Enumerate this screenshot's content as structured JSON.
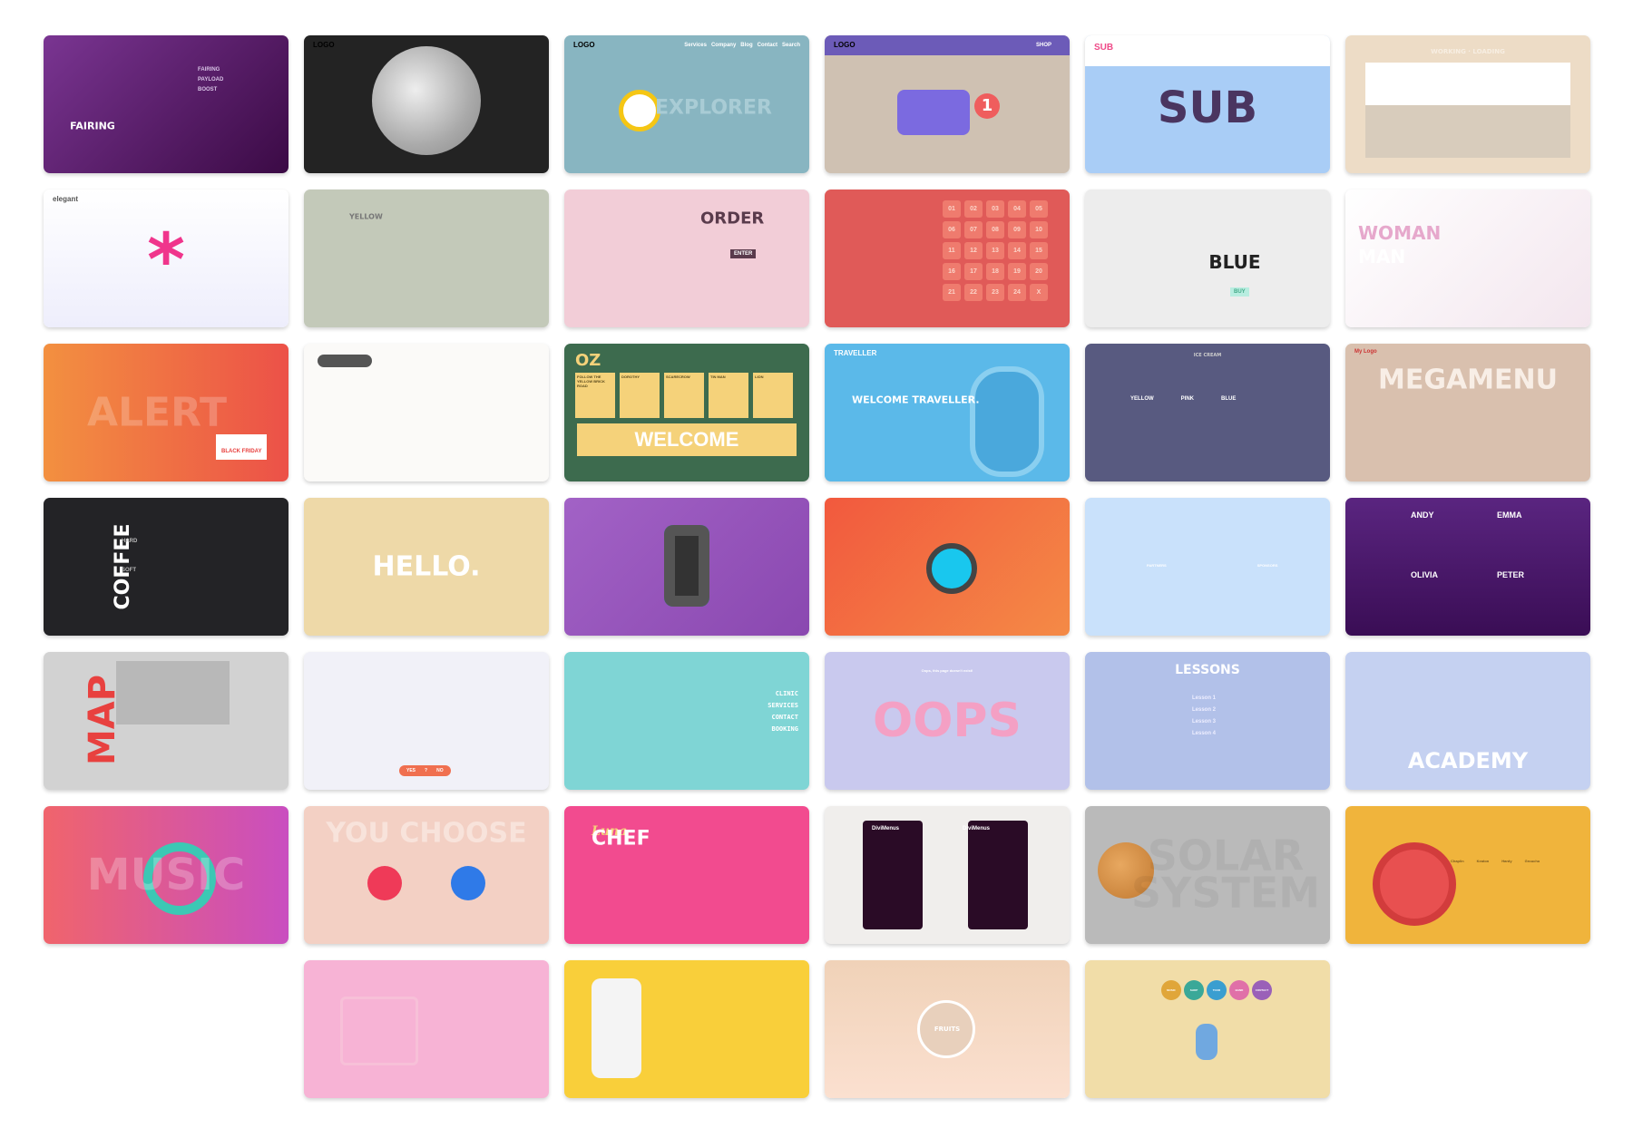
{
  "cards": [
    {
      "name": "fairing",
      "bg": "linear-gradient(135deg,#7a3592,#3b0a45)",
      "title": "FAIRING",
      "labels": [
        "FAIRING",
        "PAYLOAD",
        "BOOST"
      ]
    },
    {
      "name": "moon",
      "bg": "#232323",
      "logo": "LOGO"
    },
    {
      "name": "explorer",
      "bg": "#88b5c1",
      "logo": "LOGO",
      "title": "EXPLORER",
      "title_color": "#a9ccd5",
      "labels": [
        "Services",
        "Company",
        "Blog",
        "Contact",
        "Search"
      ]
    },
    {
      "name": "shop-cart",
      "bg": "#cfc1b2",
      "logo": "LOGO",
      "title": "1",
      "labels": [
        "SHOP"
      ]
    },
    {
      "name": "sub",
      "bg": "#a9cdf6",
      "logo": "SUB",
      "title": "SUB"
    },
    {
      "name": "working-loading",
      "bg": "#eddcc6",
      "title": "WORKING · LOADING"
    },
    {
      "name": "elegant",
      "bg": "linear-gradient(#fff,#eeeefc)",
      "logo": "elegant",
      "title": "*"
    },
    {
      "name": "macarons",
      "bg": "#c3c9b9",
      "title": "YELLOW"
    },
    {
      "name": "order",
      "bg": "#f2cdd7",
      "title": "ORDER",
      "labels": [
        "ENTER"
      ]
    },
    {
      "name": "advent",
      "bg": "#e05a58",
      "labels": [
        "01",
        "02",
        "03",
        "04",
        "05",
        "06",
        "07",
        "08",
        "09",
        "10",
        "11",
        "12",
        "13",
        "14",
        "15",
        "16",
        "17",
        "18",
        "19",
        "20",
        "21",
        "22",
        "23",
        "24",
        "X"
      ]
    },
    {
      "name": "blue",
      "bg": "#ededed",
      "title": "BLUE",
      "labels": [
        "BUY"
      ]
    },
    {
      "name": "woman-man",
      "bg": "linear-gradient(135deg,#fff,#f3e6ee)",
      "title": "WOMAN",
      "labels": [
        "MAN"
      ]
    },
    {
      "name": "alert",
      "bg": "linear-gradient(90deg,#f39040,#ec5148)",
      "title": "ALERT",
      "labels": [
        "BLACK FRIDAY"
      ]
    },
    {
      "name": "icons",
      "bg": "#fbfaf8"
    },
    {
      "name": "oz",
      "bg": "#3d6b4e",
      "title": "OZ",
      "labels": [
        "FOLLOW THE YELLOW BRICK ROAD",
        "DOROTHY",
        "SCARECROW",
        "TIN MAN",
        "LION"
      ],
      "extra": "WELCOME"
    },
    {
      "name": "traveller",
      "bg": "#5bb9e9",
      "logo": "TRAVELLER",
      "title": "WELCOME TRAVELLER."
    },
    {
      "name": "ice-cream",
      "bg": "#585a80",
      "title": "ICE CREAM",
      "labels": [
        "YELLOW",
        "PINK",
        "BLUE"
      ]
    },
    {
      "name": "megamenu",
      "bg": "#d9c0ae",
      "logo": "My Logo",
      "title": "MEGAMENU"
    },
    {
      "name": "coffee",
      "bg": "#232326",
      "title": "COFFEE",
      "labels": [
        "HARD",
        "SOFT"
      ]
    },
    {
      "name": "hello",
      "bg": "#eed9a8",
      "title": "HELLO."
    },
    {
      "name": "watch",
      "bg": "linear-gradient(135deg,#a262c6,#8a48b0)"
    },
    {
      "name": "watches",
      "bg": "linear-gradient(135deg,#f2593e,#f48a46)"
    },
    {
      "name": "partners",
      "bg": "#c9e1fb",
      "labels": [
        "PARTNERS",
        "SPONSORS"
      ]
    },
    {
      "name": "team",
      "bg": "linear-gradient(#5a2580,#3a0d55)",
      "labels": [
        "ANDY",
        "EMMA",
        "OLIVIA",
        "PETER"
      ]
    },
    {
      "name": "map",
      "bg": "#d2d2d2",
      "title": "MAP"
    },
    {
      "name": "laptop",
      "bg": "#f1f1f8",
      "labels": [
        "YES",
        "?",
        "NO"
      ]
    },
    {
      "name": "clinic",
      "bg": "#7fd5d5",
      "labels": [
        "CLINIC",
        "SERVICES",
        "CONTACT",
        "BOOKING"
      ]
    },
    {
      "name": "oops",
      "bg": "#c9c9ee",
      "title": "OOPS",
      "labels": [
        "Oops, this page doesn't exist!"
      ]
    },
    {
      "name": "lessons",
      "bg": "#b2c1e9",
      "title": "LESSONS",
      "labels": [
        "Lesson 1",
        "Lesson 2",
        "Lesson 3",
        "Lesson 4"
      ]
    },
    {
      "name": "academy",
      "bg": "#c5d1f1",
      "title": "ACADEMY"
    },
    {
      "name": "music",
      "bg": "linear-gradient(90deg,#f0646c,#c94ec0)",
      "title": "MUSIC"
    },
    {
      "name": "you-choose",
      "bg": "#f3d0c4",
      "title": "YOU CHOOSE"
    },
    {
      "name": "chef",
      "bg": "#f24b8f",
      "logo": "Luna",
      "title": "CHEF"
    },
    {
      "name": "divimenus",
      "bg": "#f0eeec",
      "labels": [
        "DiviMenus",
        "DiviMenus"
      ]
    },
    {
      "name": "solar",
      "bg": "#bababa",
      "title": "SOLAR SYSTEM"
    },
    {
      "name": "film",
      "bg": "#f0b43c",
      "labels": [
        "Chaplin",
        "Keaton",
        "Hardy",
        "Groucho"
      ]
    },
    {
      "name": "pink-cart",
      "bg": "#f7b3d5"
    },
    {
      "name": "lemon",
      "bg": "#f9cf3a"
    },
    {
      "name": "fruits",
      "bg": "linear-gradient(#f0d2b8,#fbe0d0)",
      "title": "FRUITS"
    },
    {
      "name": "microphone",
      "bg": "#f1dda8",
      "labels": [
        "MUSIC",
        "SHOP",
        "TOUR",
        "BAND",
        "CONTACT"
      ],
      "label_colors": [
        "#e0a63a",
        "#3aa898",
        "#3a9ed0",
        "#e070a8",
        "#9a60b8"
      ]
    }
  ]
}
